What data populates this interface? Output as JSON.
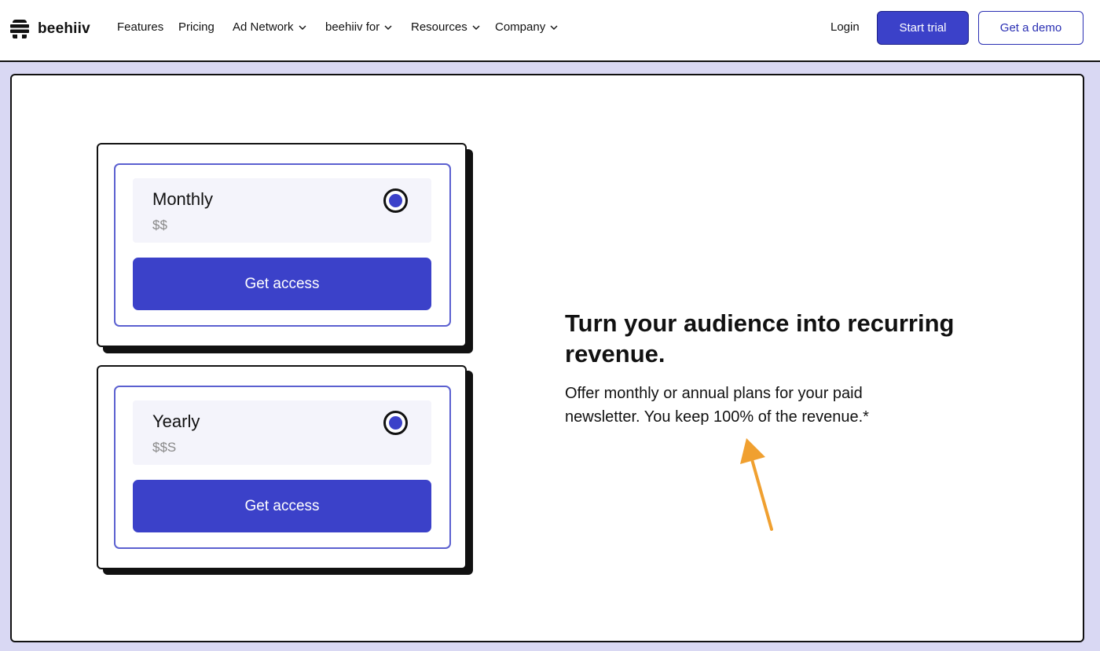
{
  "brand": {
    "name": "beehiiv",
    "logo_icon": "beehive-icon"
  },
  "nav": {
    "items": [
      {
        "label": "Features",
        "dropdown": false
      },
      {
        "label": "Pricing",
        "dropdown": false
      },
      {
        "label": "Ad Network",
        "dropdown": true
      },
      {
        "label": "beehiiv for",
        "dropdown": true
      },
      {
        "label": "Resources",
        "dropdown": true
      },
      {
        "label": "Company",
        "dropdown": true
      }
    ],
    "login_label": "Login",
    "start_trial_label": "Start trial",
    "get_demo_label": "Get a demo"
  },
  "plans": [
    {
      "name": "Monthly",
      "price": "$$",
      "selected": true,
      "button_label": "Get access"
    },
    {
      "name": "Yearly",
      "price": "$$S",
      "selected": true,
      "button_label": "Get access"
    }
  ],
  "content": {
    "headline": "Turn your audience into recurring revenue.",
    "subtext": "Offer monthly or annual plans for your paid newsletter. You keep 100% of the revenue.*"
  },
  "colors": {
    "accent": "#3b41c9",
    "page_background": "#d9d8f3",
    "annotation_arrow": "#f0a030"
  }
}
